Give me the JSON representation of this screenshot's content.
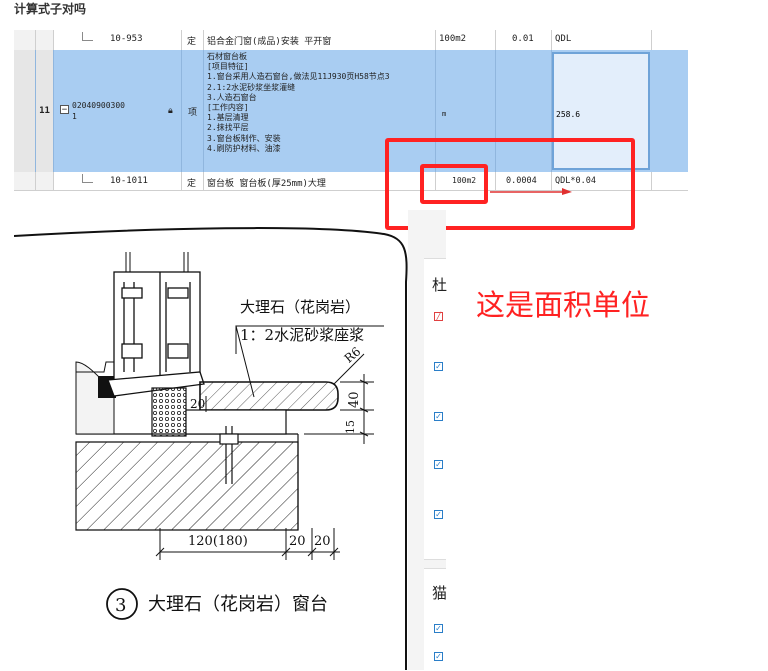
{
  "page_title": "计算式子对吗",
  "rows": [
    {
      "index": "",
      "code": "10-953",
      "type": "定",
      "name": "铝合金门窗(成品)安装 平开窗",
      "unit": "100m2",
      "quantity": "0.01",
      "expression": "QDL"
    },
    {
      "index": "11",
      "code_line1": "02040900300",
      "code_line2": "1",
      "type": "项",
      "description_lines": [
        "石材窗台板",
        "[项目特征]",
        "1.窗台采用人造石窗台,做法见11J930页H58节点3",
        "2.1:2水泥砂浆坐浆灌缝",
        "3.人造石窗台",
        "[工作内容]",
        "1.基层清理",
        "2.抹找平层",
        "3.窗台板制作、安装",
        "4.刷防护材料、油漆"
      ],
      "unit": "m",
      "quantity": "",
      "expression": "258.6"
    },
    {
      "index": "",
      "code": "10-1011",
      "type": "定",
      "name": "窗台板 窗台板(厚25mm)大理",
      "unit": "100m2",
      "quantity": "0.0004",
      "expression": "QDL*0.04"
    }
  ],
  "annotation": "这是面积单位",
  "drawing": {
    "label_material": "大理石（花岗岩）",
    "label_mortar": "1：2水泥砂浆座浆",
    "dim_radius": "R6",
    "dim_40": "40",
    "dim_15": "15",
    "dim_20_left": "20",
    "dim_120": "120(180)",
    "dim_20_a": "20",
    "dim_20_b": "20",
    "detail_number": "3",
    "caption": "大理石（花岗岩）窗台"
  },
  "side_panel": {
    "chars": [
      "杜",
      "猫"
    ]
  },
  "colors": {
    "selected_row": "#a9cdf2",
    "highlight_red": "#ff2222",
    "checkbox_blue": "#2a7ec8"
  }
}
